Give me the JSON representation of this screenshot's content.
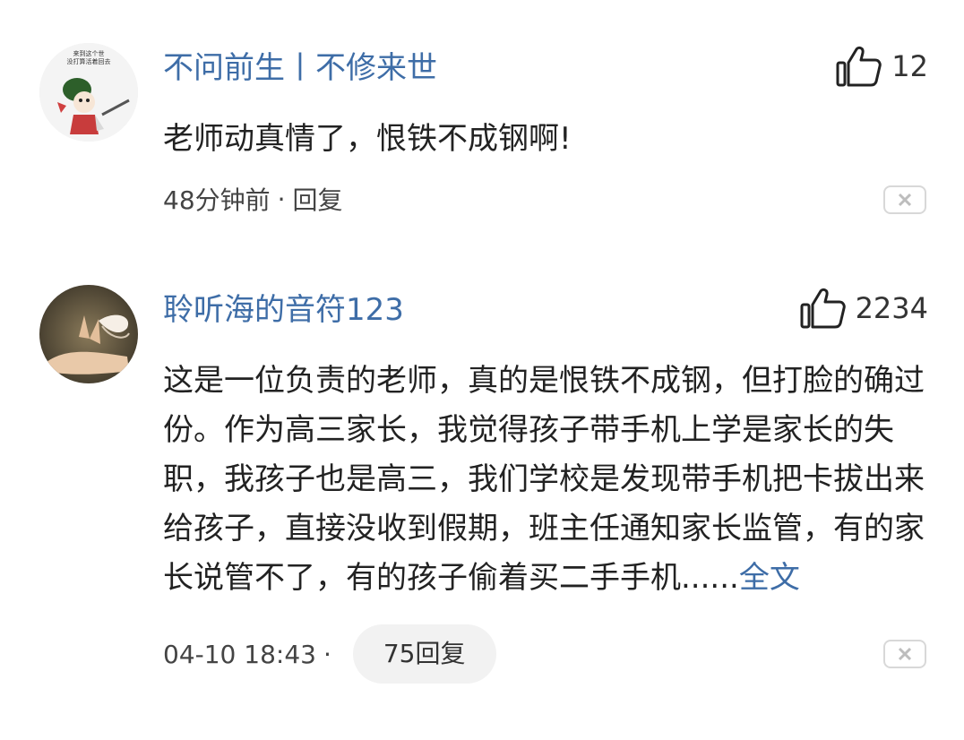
{
  "comments": [
    {
      "username": "不问前生丨不修来世",
      "likes": "12",
      "text": "老师动真情了，恨铁不成钢啊!",
      "time": "48分钟前",
      "separator": "·",
      "reply_label": "回复",
      "avatar_caption": "来到这个世 没打算活着回去"
    },
    {
      "username": "聆听海的音符123",
      "likes": "2234",
      "text": "这是一位负责的老师，真的是恨铁不成钢，但打脸的确过份。作为高三家长，我觉得孩子带手机上学是家长的失职，我孩子也是高三，我们学校是发现带手机把卡拔出来给孩子，直接没收到假期，班主任通知家长监管，有的家长说管不了，有的孩子偷着买二手手机......",
      "more_label": "全文",
      "time": "04-10 18:43",
      "separator": "·",
      "reply_count_label": "75回复"
    }
  ],
  "icons": {
    "like": "thumbs-up-icon",
    "dismiss": "close-icon"
  },
  "colors": {
    "username": "#3e6da7",
    "link": "#3e6da7"
  }
}
